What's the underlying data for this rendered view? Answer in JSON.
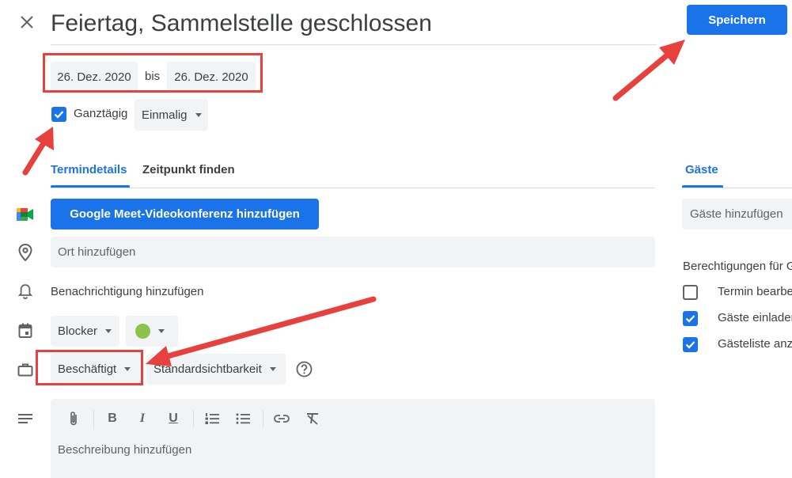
{
  "header": {
    "title": "Feiertag, Sammelstelle geschlossen",
    "save_label": "Speichern"
  },
  "dates": {
    "start": "26. Dez. 2020",
    "separator": "bis",
    "end": "26. Dez. 2020"
  },
  "options": {
    "all_day_label": "Ganztägig",
    "all_day_checked": true,
    "recurrence": "Einmalig"
  },
  "tabs": {
    "details": "Termindetails",
    "find_time": "Zeitpunkt finden"
  },
  "details": {
    "meet_button": "Google Meet-Videokonferenz hinzufügen",
    "location_placeholder": "Ort hinzufügen",
    "notification_label": "Benachrichtigung hinzufügen",
    "calendar": "Blocker",
    "event_color": "#8bc34a",
    "availability": "Beschäftigt",
    "visibility": "Standardsichtbarkeit",
    "description_placeholder": "Beschreibung hinzufügen"
  },
  "editor_toolbar": [
    "attach-icon",
    "bold-icon",
    "italic-icon",
    "underline-icon",
    "numbered-list-icon",
    "bulleted-list-icon",
    "link-icon",
    "clear-formatting-icon"
  ],
  "guests": {
    "tab_label": "Gäste",
    "add_placeholder": "Gäste hinzufügen",
    "permissions_title": "Berechtigungen für Gäste",
    "permissions": [
      {
        "label": "Termin bearbeiten",
        "checked": false
      },
      {
        "label": "Gäste einladen",
        "checked": true
      },
      {
        "label": "Gästeliste anzeigen",
        "checked": true
      }
    ]
  },
  "colors": {
    "accent": "#1a73e8",
    "annotation": "#e8413d",
    "field_bg": "#f1f3f4"
  }
}
